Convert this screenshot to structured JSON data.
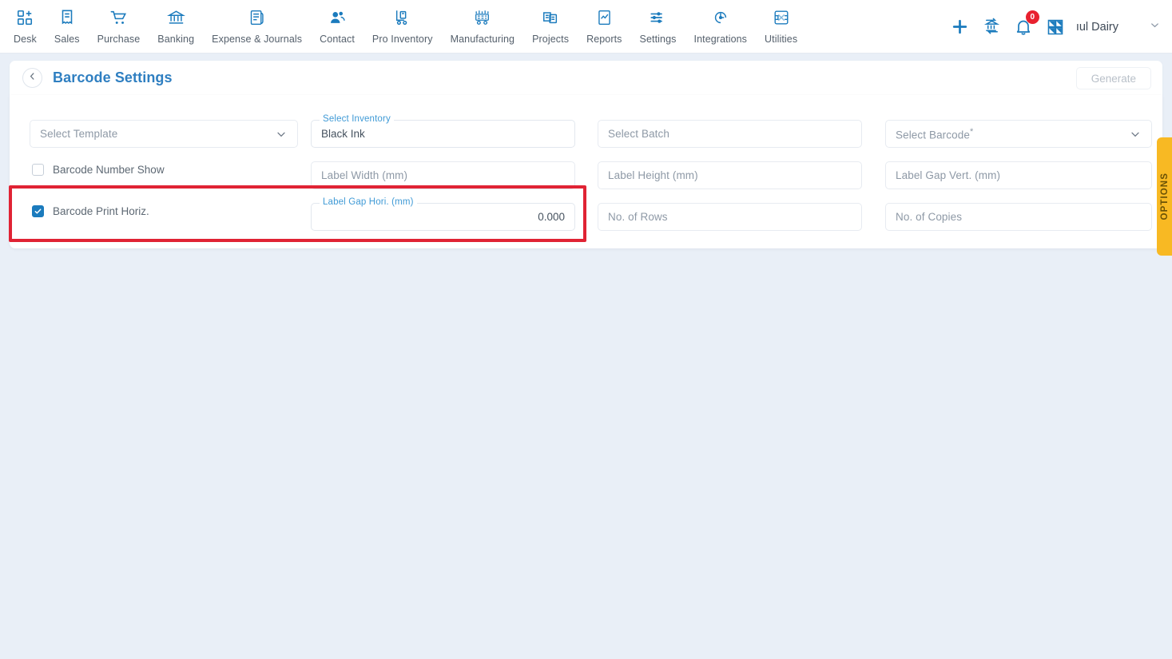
{
  "colors": {
    "brand_blue": "#1b7bbd",
    "title_blue": "#2f7fc1",
    "float_label_blue": "#3f9ad6",
    "annotation_red": "#e02334",
    "options_yellow": "#f8b923",
    "badge_red": "#e8212f",
    "page_bg": "#e9eff7"
  },
  "topnav": {
    "items": [
      {
        "label": "Desk",
        "icon": "dashboard-grid-plus-icon"
      },
      {
        "label": "Sales",
        "icon": "receipt-icon"
      },
      {
        "label": "Purchase",
        "icon": "shopping-cart-icon"
      },
      {
        "label": "Banking",
        "icon": "bank-icon"
      },
      {
        "label": "Expense & Journals",
        "icon": "ledger-book-icon"
      },
      {
        "label": "Contact",
        "icon": "people-icon"
      },
      {
        "label": "Pro Inventory",
        "icon": "hand-truck-icon"
      },
      {
        "label": "Manufacturing",
        "icon": "factory-machine-icon"
      },
      {
        "label": "Projects",
        "icon": "clipboard-tasks-icon"
      },
      {
        "label": "Reports",
        "icon": "chart-document-icon"
      },
      {
        "label": "Settings",
        "icon": "sliders-icon"
      },
      {
        "label": "Integrations",
        "icon": "plug-power-icon"
      },
      {
        "label": "Utilities",
        "icon": "tools-puzzle-icon"
      }
    ],
    "right": {
      "add_icon": "plus-icon",
      "transfer_icon": "bank-transfer-icon",
      "notification_icon": "bell-icon",
      "notification_count": "0",
      "apps_icon": "app-grid-icon",
      "user_name": "ıul Dairy",
      "caret_icon": "chevron-down-icon"
    }
  },
  "header": {
    "back_icon": "chevron-left-icon",
    "title": "Barcode Settings",
    "generate_label": "Generate"
  },
  "form": {
    "select_template": {
      "placeholder": "Select Template",
      "value": "",
      "chevron": "chevron-down-icon"
    },
    "select_inventory": {
      "label": "Select Inventory",
      "value": "Black Ink"
    },
    "select_batch": {
      "placeholder": "Select Batch",
      "value": ""
    },
    "select_barcode": {
      "placeholder": "Select Barcode",
      "required_mark": "*",
      "value": "",
      "chevron": "chevron-down-icon"
    },
    "barcode_number_show": {
      "label": "Barcode Number Show",
      "checked": false
    },
    "label_width": {
      "placeholder": "Label Width (mm)",
      "value": ""
    },
    "label_height": {
      "placeholder": "Label Height (mm)",
      "value": ""
    },
    "label_gap_vert": {
      "placeholder": "Label Gap Vert. (mm)",
      "value": ""
    },
    "barcode_print_horiz": {
      "label": "Barcode Print Horiz.",
      "checked": true
    },
    "label_gap_hori": {
      "label": "Label Gap Hori. (mm)",
      "value": "0.000"
    },
    "no_of_rows": {
      "placeholder": "No. of Rows",
      "value": ""
    },
    "no_of_copies": {
      "placeholder": "No. of Copies",
      "value": ""
    }
  },
  "options_tab": {
    "label": "OPTIONS"
  }
}
